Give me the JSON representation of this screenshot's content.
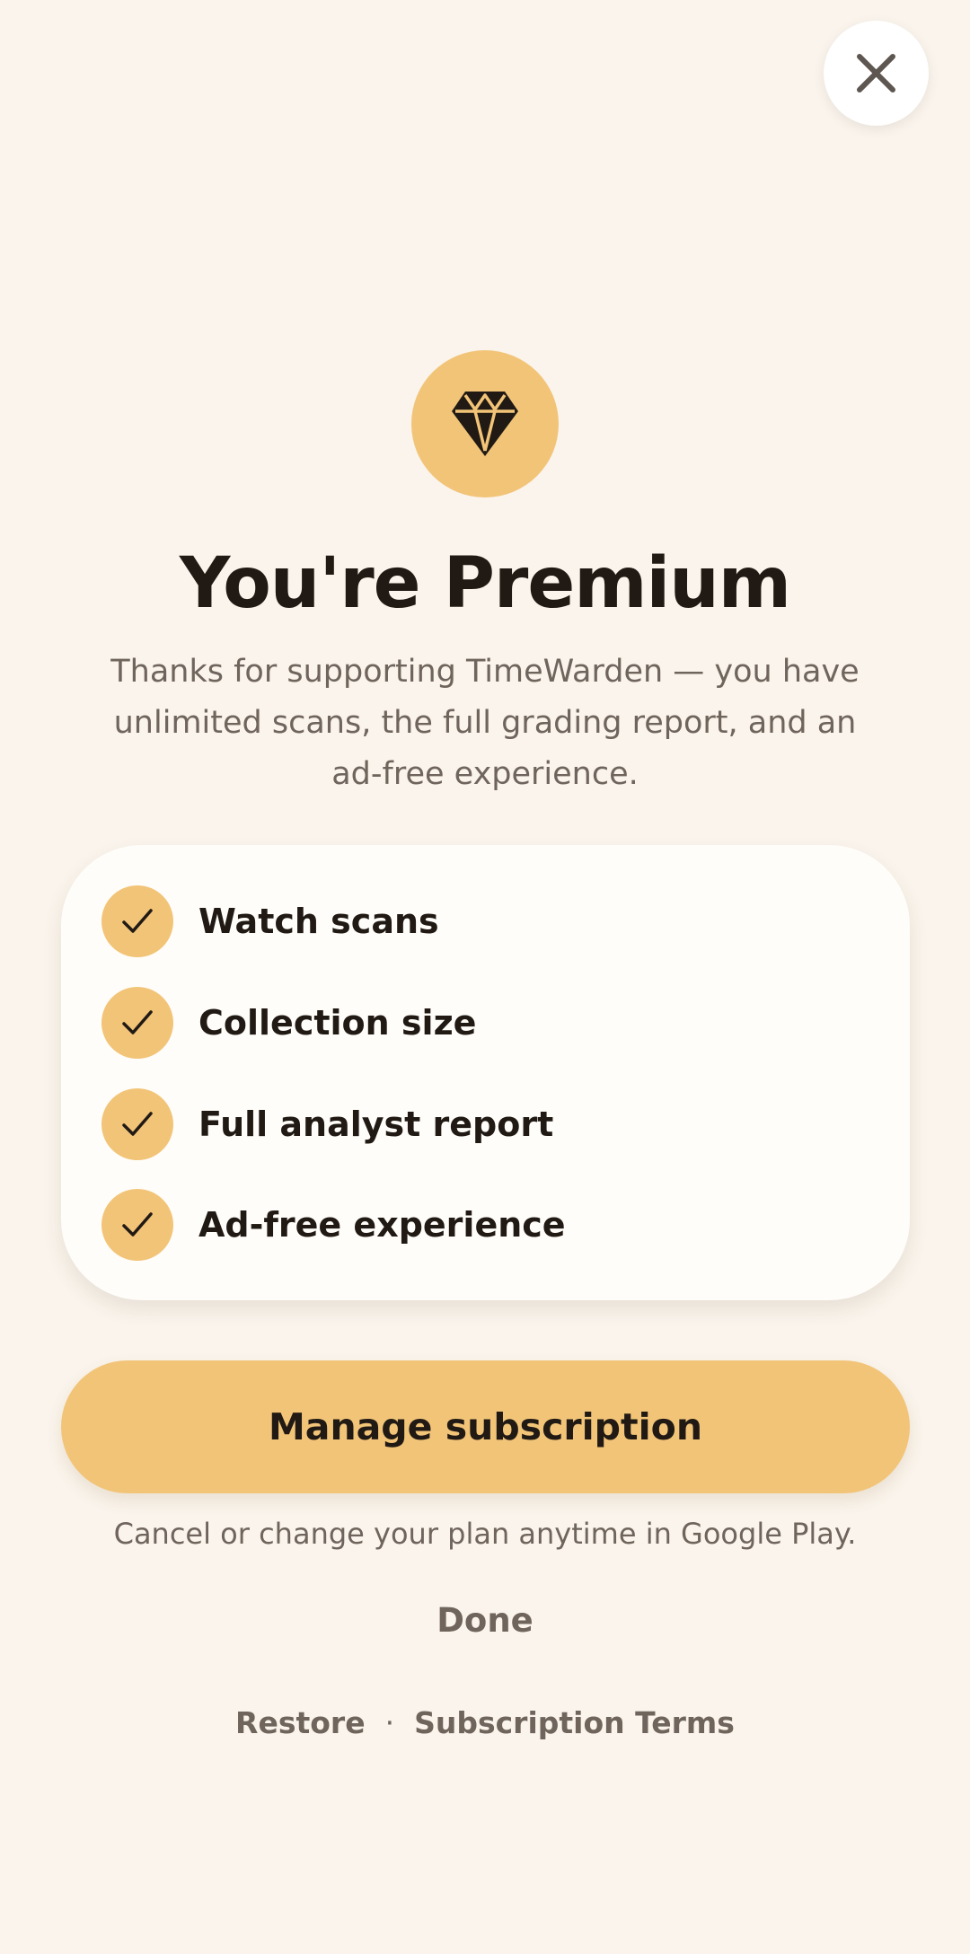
{
  "header": {
    "close_icon": "close-icon"
  },
  "hero": {
    "icon": "diamond-icon",
    "title": "You're Premium",
    "subtitle": "Thanks for supporting TimeWarden — you have unlimited scans, the full grading report, and an ad-free experience."
  },
  "features": [
    {
      "label": "Watch scans",
      "icon": "check-icon"
    },
    {
      "label": "Collection size",
      "icon": "check-icon"
    },
    {
      "label": "Full analyst report",
      "icon": "check-icon"
    },
    {
      "label": "Ad-free experience",
      "icon": "check-icon"
    }
  ],
  "actions": {
    "manage_label": "Manage subscription",
    "cancel_note": "Cancel or change your plan anytime in Google Play.",
    "done_label": "Done"
  },
  "footer": {
    "restore_label": "Restore",
    "separator": "·",
    "terms_label": "Subscription Terms"
  },
  "colors": {
    "background": "#faf4ec",
    "accent": "#f2c478",
    "text_primary": "#211a14",
    "text_secondary": "#6f655c",
    "card": "#fffdf9"
  }
}
